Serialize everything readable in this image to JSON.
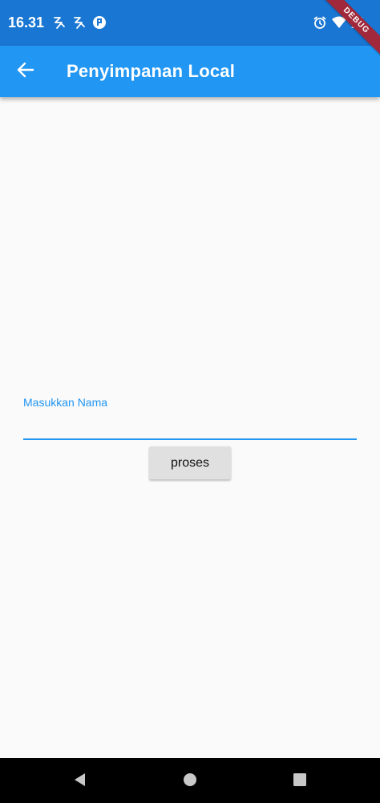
{
  "status_bar": {
    "time": "16.31",
    "left_icons": [
      "scribble-icon",
      "scribble-icon",
      "app-notification-icon"
    ],
    "right_icons": [
      "alarm-icon",
      "wifi-icon",
      "signal-icon"
    ]
  },
  "debug_banner": {
    "label": "DEBUG"
  },
  "app_bar": {
    "title": "Penyimpanan Local",
    "back_icon": "arrow-back-icon"
  },
  "form": {
    "name_label": "Masukkan Nama",
    "name_value": "",
    "submit_label": "proses"
  },
  "nav_bar": {
    "buttons": [
      "back-triangle-icon",
      "home-circle-icon",
      "recents-square-icon"
    ]
  },
  "colors": {
    "status_bar": "#1976d2",
    "app_bar": "#2196f3",
    "accent": "#2196f3",
    "background": "#fafafa",
    "button": "#e0e0e0",
    "nav_bar": "#000000"
  }
}
